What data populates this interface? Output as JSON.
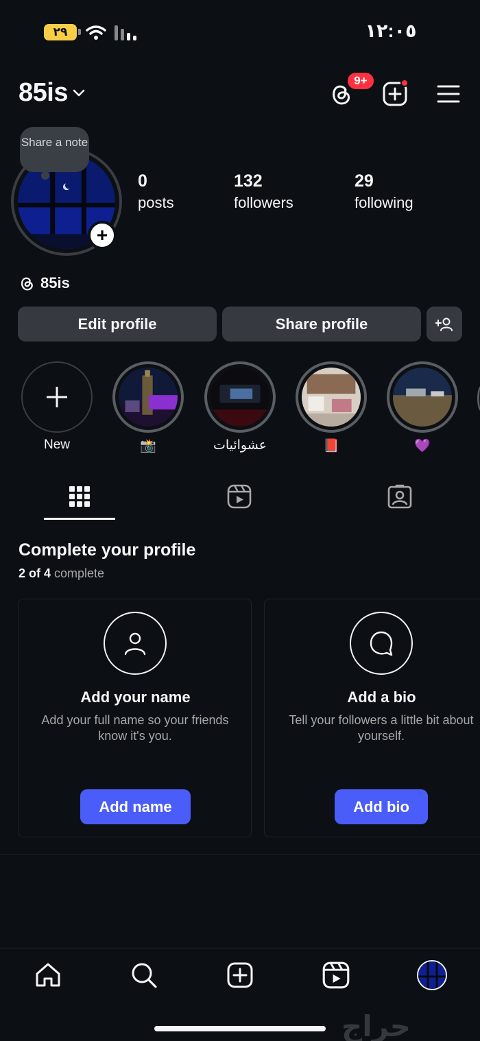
{
  "status_bar": {
    "battery": "٢٩",
    "time": "١٢:٠٥"
  },
  "header": {
    "username": "85is",
    "threads_badge": "9+"
  },
  "profile": {
    "note_text": "Share a note",
    "stats": [
      {
        "value": "0",
        "label": "posts"
      },
      {
        "value": "132",
        "label": "followers"
      },
      {
        "value": "29",
        "label": "following"
      }
    ],
    "threads_handle": "85is",
    "edit_label": "Edit profile",
    "share_label": "Share profile"
  },
  "highlights": [
    {
      "label": "New"
    },
    {
      "label": "📸"
    },
    {
      "label": "عشوائيات"
    },
    {
      "label": "📕"
    },
    {
      "label": "💜"
    }
  ],
  "complete_profile": {
    "title": "Complete your profile",
    "progress_done": "2 of 4",
    "progress_suffix": "complete",
    "cards": [
      {
        "title": "Add your name",
        "desc": "Add your full name so your friends know it's you.",
        "button": "Add name"
      },
      {
        "title": "Add a bio",
        "desc": "Tell your followers a little bit about yourself.",
        "button": "Add bio"
      }
    ]
  },
  "watermark": "حراج",
  "colors": {
    "background": "#0c1014",
    "accent": "#4a5df9",
    "badge": "#ff3040",
    "button_bg": "#363a40"
  }
}
